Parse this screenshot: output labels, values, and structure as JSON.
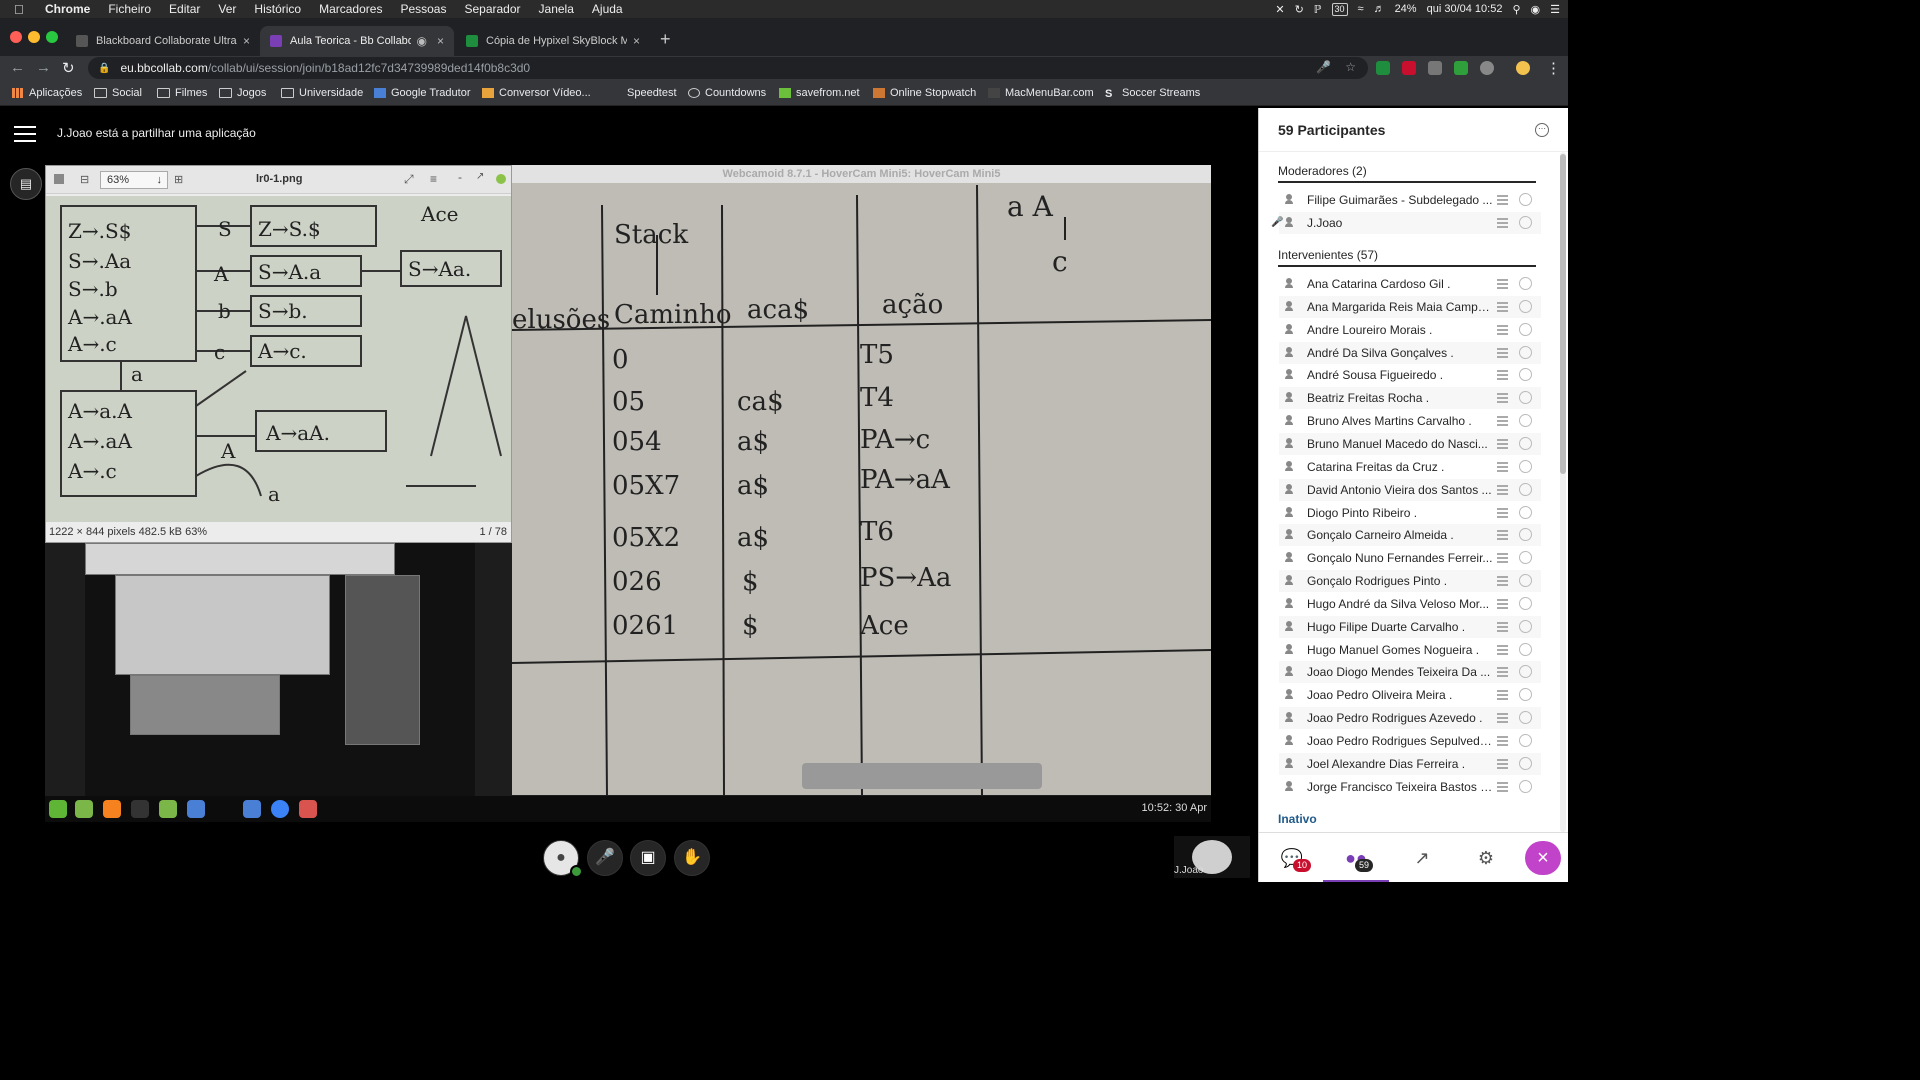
{
  "menubar": {
    "app": "Chrome",
    "items": [
      "Ficheiro",
      "Editar",
      "Ver",
      "Histórico",
      "Marcadores",
      "Pessoas",
      "Separador",
      "Janela",
      "Ajuda"
    ],
    "status": {
      "battery_box": "30",
      "battery": "24%",
      "clock": "qui 30/04  10:52"
    }
  },
  "tabs": [
    {
      "title": "Blackboard Collaborate Ultra - ...",
      "color": "#555555"
    },
    {
      "title": "Aula Teorica - Bb Collabora",
      "color": "#7b3fb5"
    },
    {
      "title": "Cópia de Hypixel SkyBlock Min",
      "color": "#1e8e3e"
    }
  ],
  "address": {
    "host": "eu.bbcollab.com",
    "path": "/collab/ui/session/join/b18ad12fc7d34739989ded14f0b8c3d0"
  },
  "bookmarks": [
    {
      "label": "Aplicações",
      "icon": "apps-grid-icon"
    },
    {
      "label": "Social",
      "icon": "folder-icon"
    },
    {
      "label": "Filmes",
      "icon": "folder-icon"
    },
    {
      "label": "Jogos",
      "icon": "folder-icon"
    },
    {
      "label": "Universidade",
      "icon": "folder-icon"
    },
    {
      "label": "Google Tradutor",
      "icon": "translate-icon"
    },
    {
      "label": "Conversor Vídeo...",
      "icon": "converter-icon"
    },
    {
      "label": "Speedtest",
      "icon": ""
    },
    {
      "label": "Countdowns",
      "icon": "clock-icon"
    },
    {
      "label": "savefrom.net",
      "icon": "download-icon"
    },
    {
      "label": "Online Stopwatch",
      "icon": "stopwatch-icon"
    },
    {
      "label": "MacMenuBar.com",
      "icon": "menubar-icon"
    },
    {
      "label": "Soccer Streams",
      "icon": "s-icon"
    }
  ],
  "session": {
    "sharing_message": "J.Joao está a partilhar uma aplicação"
  },
  "viewer": {
    "zoom": "63%",
    "filename": "lr0-1.png",
    "status": "1222 × 844 pixels  482.5 kB   63%",
    "page": "1 / 78"
  },
  "webcam": {
    "window_title": "Webcamoid 8.7.1 - HoverCam Mini5: HoverCam Mini5",
    "headers": [
      "elusões",
      "Stack",
      "Caminho",
      "aca$",
      "ação"
    ],
    "rows": [
      [
        "0",
        "",
        "T5"
      ],
      [
        "05",
        "ca$",
        "T4"
      ],
      [
        "054",
        "a$",
        "PA→c"
      ],
      [
        "05X7",
        "a$",
        "PA→aA"
      ],
      [
        "05X2",
        "a$",
        "T6"
      ],
      [
        "026",
        "$",
        "PS→Aa"
      ],
      [
        "0261",
        "$",
        "Ace"
      ]
    ]
  },
  "shared_taskbar": {
    "clock": "10:52: 30 Apr"
  },
  "self_tile": {
    "name": "J.Joao"
  },
  "panel": {
    "title": "59 Participantes",
    "moderators_title": "Moderadores (2)",
    "moderators": [
      "Filipe Guimarães - Subdelegado ...",
      "J.Joao"
    ],
    "participants_title": "Intervenientes (57)",
    "participants": [
      "Ana Catarina Cardoso Gil .",
      "Ana Margarida Reis Maia Campo...",
      "Andre Loureiro Morais .",
      "André Da Silva Gonçalves .",
      "André Sousa Figueiredo .",
      "Beatriz Freitas Rocha .",
      "Bruno Alves Martins Carvalho .",
      "Bruno Manuel Macedo do Nasci...",
      "Catarina Freitas da Cruz .",
      "David Antonio Vieira dos Santos ...",
      "Diogo Pinto Ribeiro .",
      "Gonçalo Carneiro Almeida .",
      "Gonçalo Nuno Fernandes Ferreir...",
      "Gonçalo Rodrigues Pinto .",
      "Hugo André da Silva Veloso Mor...",
      "Hugo Filipe Duarte Carvalho .",
      "Hugo Manuel Gomes Nogueira .",
      "Joao Diogo Mendes Teixeira Da ...",
      "Joao Pedro Oliveira Meira .",
      "Joao Pedro Rodrigues Azevedo .",
      "Joao Pedro Rodrigues Sepulveda...",
      "Joel Alexandre Dias Ferreira .",
      "Jorge Francisco Teixeira Bastos d..."
    ],
    "inactive_label": "Inativo",
    "footer": {
      "chat_badge": "10",
      "participants_badge": "59"
    }
  }
}
